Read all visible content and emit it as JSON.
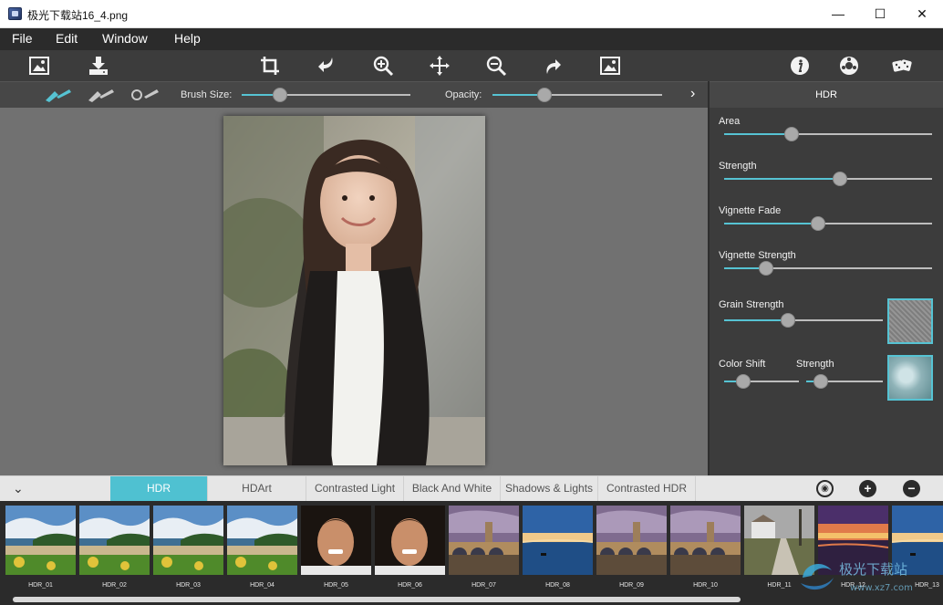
{
  "window": {
    "title": "极光下载站16_4.png",
    "minimize": "—",
    "maximize": "☐",
    "close": "✕"
  },
  "menu": [
    "File",
    "Edit",
    "Window",
    "Help"
  ],
  "toolbar": {
    "icons": [
      "open-image-icon",
      "save-icon",
      "crop-icon",
      "undo-icon",
      "zoom-in-icon",
      "move-icon",
      "zoom-out-icon",
      "redo-icon",
      "fit-image-icon",
      "info-icon",
      "settings-icon",
      "random-dice-icon"
    ]
  },
  "brushbar": {
    "brush_size_label": "Brush Size:",
    "brush_size_value": 0.2,
    "opacity_label": "Opacity:",
    "opacity_value": 0.29
  },
  "panel": {
    "header": "HDR",
    "sliders": [
      {
        "label": "Area",
        "value": 0.31
      },
      {
        "label": "Strength",
        "value": 0.56
      },
      {
        "label": "Vignette Fade",
        "value": 0.45
      },
      {
        "label": "Vignette Strength",
        "value": 0.18
      },
      {
        "label": "Grain Strength",
        "value": 0.39
      },
      {
        "label": "Color Shift",
        "value": 0.2
      },
      {
        "label": "Strength",
        "value": 0.12
      }
    ]
  },
  "tabs": [
    {
      "label": "HDR",
      "active": true
    },
    {
      "label": "HDArt",
      "active": false
    },
    {
      "label": "Contrasted Light",
      "active": false
    },
    {
      "label": "Black And White",
      "active": false
    },
    {
      "label": "Shadows & Lights",
      "active": false
    },
    {
      "label": "Contrasted HDR",
      "active": false
    }
  ],
  "tab_actions": {
    "collapse": "⌄",
    "add": "+",
    "remove": "−"
  },
  "presets": [
    {
      "label": "HDR_01",
      "scene": "beach"
    },
    {
      "label": "HDR_02",
      "scene": "beach"
    },
    {
      "label": "HDR_03",
      "scene": "beach"
    },
    {
      "label": "HDR_04",
      "scene": "beach"
    },
    {
      "label": "HDR_05",
      "scene": "portrait"
    },
    {
      "label": "HDR_06",
      "scene": "portrait"
    },
    {
      "label": "HDR_07",
      "scene": "bridge"
    },
    {
      "label": "HDR_08",
      "scene": "sunset-lake"
    },
    {
      "label": "HDR_09",
      "scene": "bridge"
    },
    {
      "label": "HDR_10",
      "scene": "bridge"
    },
    {
      "label": "HDR_11",
      "scene": "path"
    },
    {
      "label": "HDR_12",
      "scene": "dusk"
    },
    {
      "label": "HDR_13",
      "scene": "sunset-lake"
    }
  ],
  "watermark": "极光下载站",
  "colors": {
    "accent": "#56c3d3",
    "tab_active": "#4fc1d1"
  }
}
